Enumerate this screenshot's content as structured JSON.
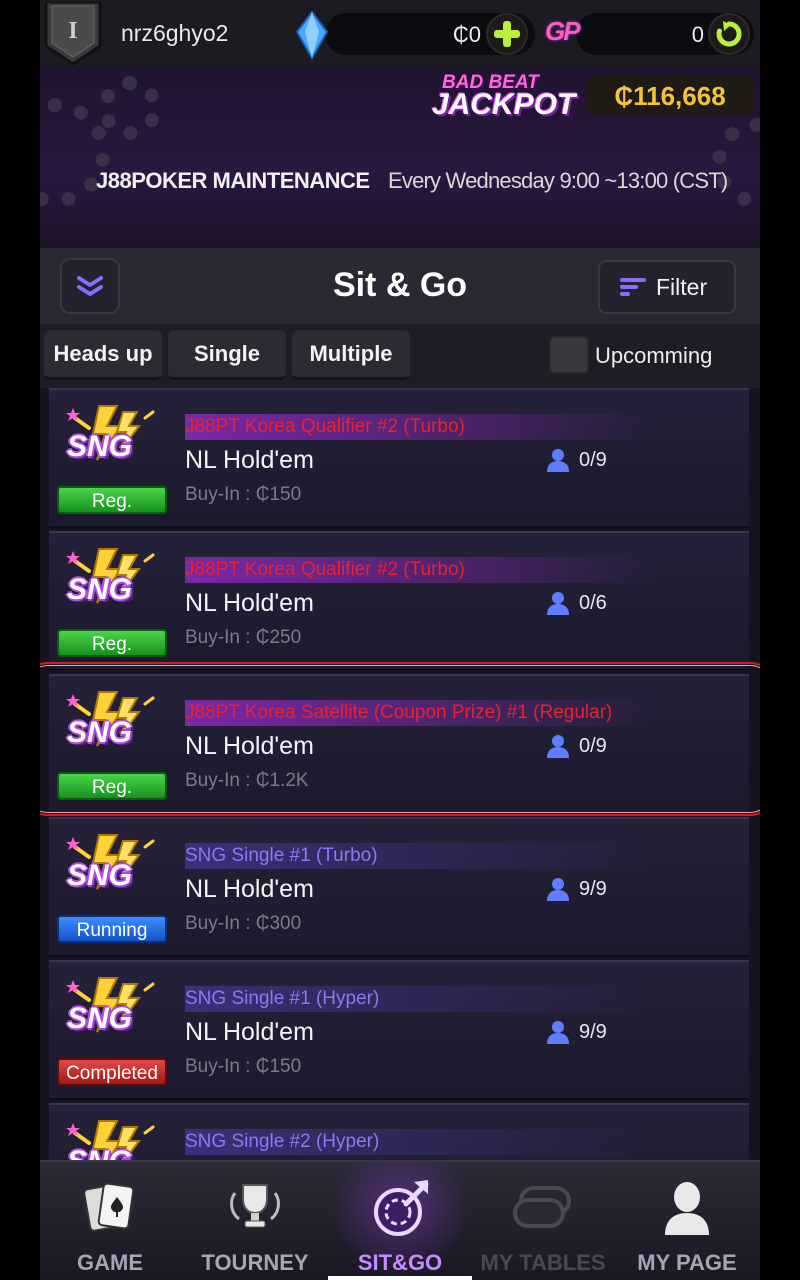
{
  "topbar": {
    "rank_letter": "I",
    "username": "nrz6ghyo2",
    "coin_balance": "₵0",
    "gp_logo": "GP",
    "gp_balance": "0"
  },
  "banner": {
    "jackpot_line1": "BAD BEAT",
    "jackpot_line2": "JACKPOT",
    "jackpot_amount": "₵116,668",
    "maintenance_title": "J88POKER MAINTENANCE",
    "maintenance_time": "Every Wednesday 9:00 ~13:00 (CST)"
  },
  "header": {
    "title": "Sit & Go",
    "filter_label": "Filter"
  },
  "tabs": {
    "heads_up": "Heads up",
    "single": "Single",
    "multiple": "Multiple",
    "upcoming_label": "Upcomming",
    "upcoming_checked": false
  },
  "tournaments": [
    {
      "logo": "SNG",
      "name": "J88PT Korea Qualifier #2 (Turbo)",
      "name_color": "red",
      "game": "NL Hold'em",
      "buyin": "Buy-In : ₵150",
      "players": "0/9",
      "status": "Reg.",
      "status_type": "reg"
    },
    {
      "logo": "SNG",
      "name": "J88PT Korea Qualifier #2 (Turbo)",
      "name_color": "red",
      "game": "NL Hold'em",
      "buyin": "Buy-In : ₵250",
      "players": "0/6",
      "status": "Reg.",
      "status_type": "reg"
    },
    {
      "logo": "SNG",
      "name": "J88PT Korea Satellite (Coupon Prize) #1 (Regular)",
      "name_color": "red",
      "game": "NL Hold'em",
      "buyin": "Buy-In : ₵1.2K",
      "players": "0/9",
      "status": "Reg.",
      "status_type": "reg"
    },
    {
      "logo": "SNG",
      "name": "SNG Single #1 (Turbo)",
      "name_color": "purple",
      "game": "NL Hold'em",
      "buyin": "Buy-In : ₵300",
      "players": "9/9",
      "status": "Running",
      "status_type": "running"
    },
    {
      "logo": "SNG",
      "name": "SNG Single #1 (Hyper)",
      "name_color": "purple",
      "game": "NL Hold'em",
      "buyin": "Buy-In : ₵150",
      "players": "9/9",
      "status": "Completed",
      "status_type": "completed"
    },
    {
      "logo": "SNG",
      "name": "SNG Single #2 (Hyper)",
      "name_color": "purple"
    }
  ],
  "bottom_nav": {
    "game": "GAME",
    "tourney": "TOURNEY",
    "sitgo": "SIT&GO",
    "my_tables": "MY TABLES",
    "my_page": "MY PAGE",
    "active": "SIT&GO"
  },
  "colors": {
    "accent_purple": "#c38bff",
    "jackpot_gold": "#f3c43a",
    "reg_green": "#17911c",
    "running_blue": "#1553c9",
    "completed_red": "#a41717",
    "highlight_red": "#c81e28"
  }
}
